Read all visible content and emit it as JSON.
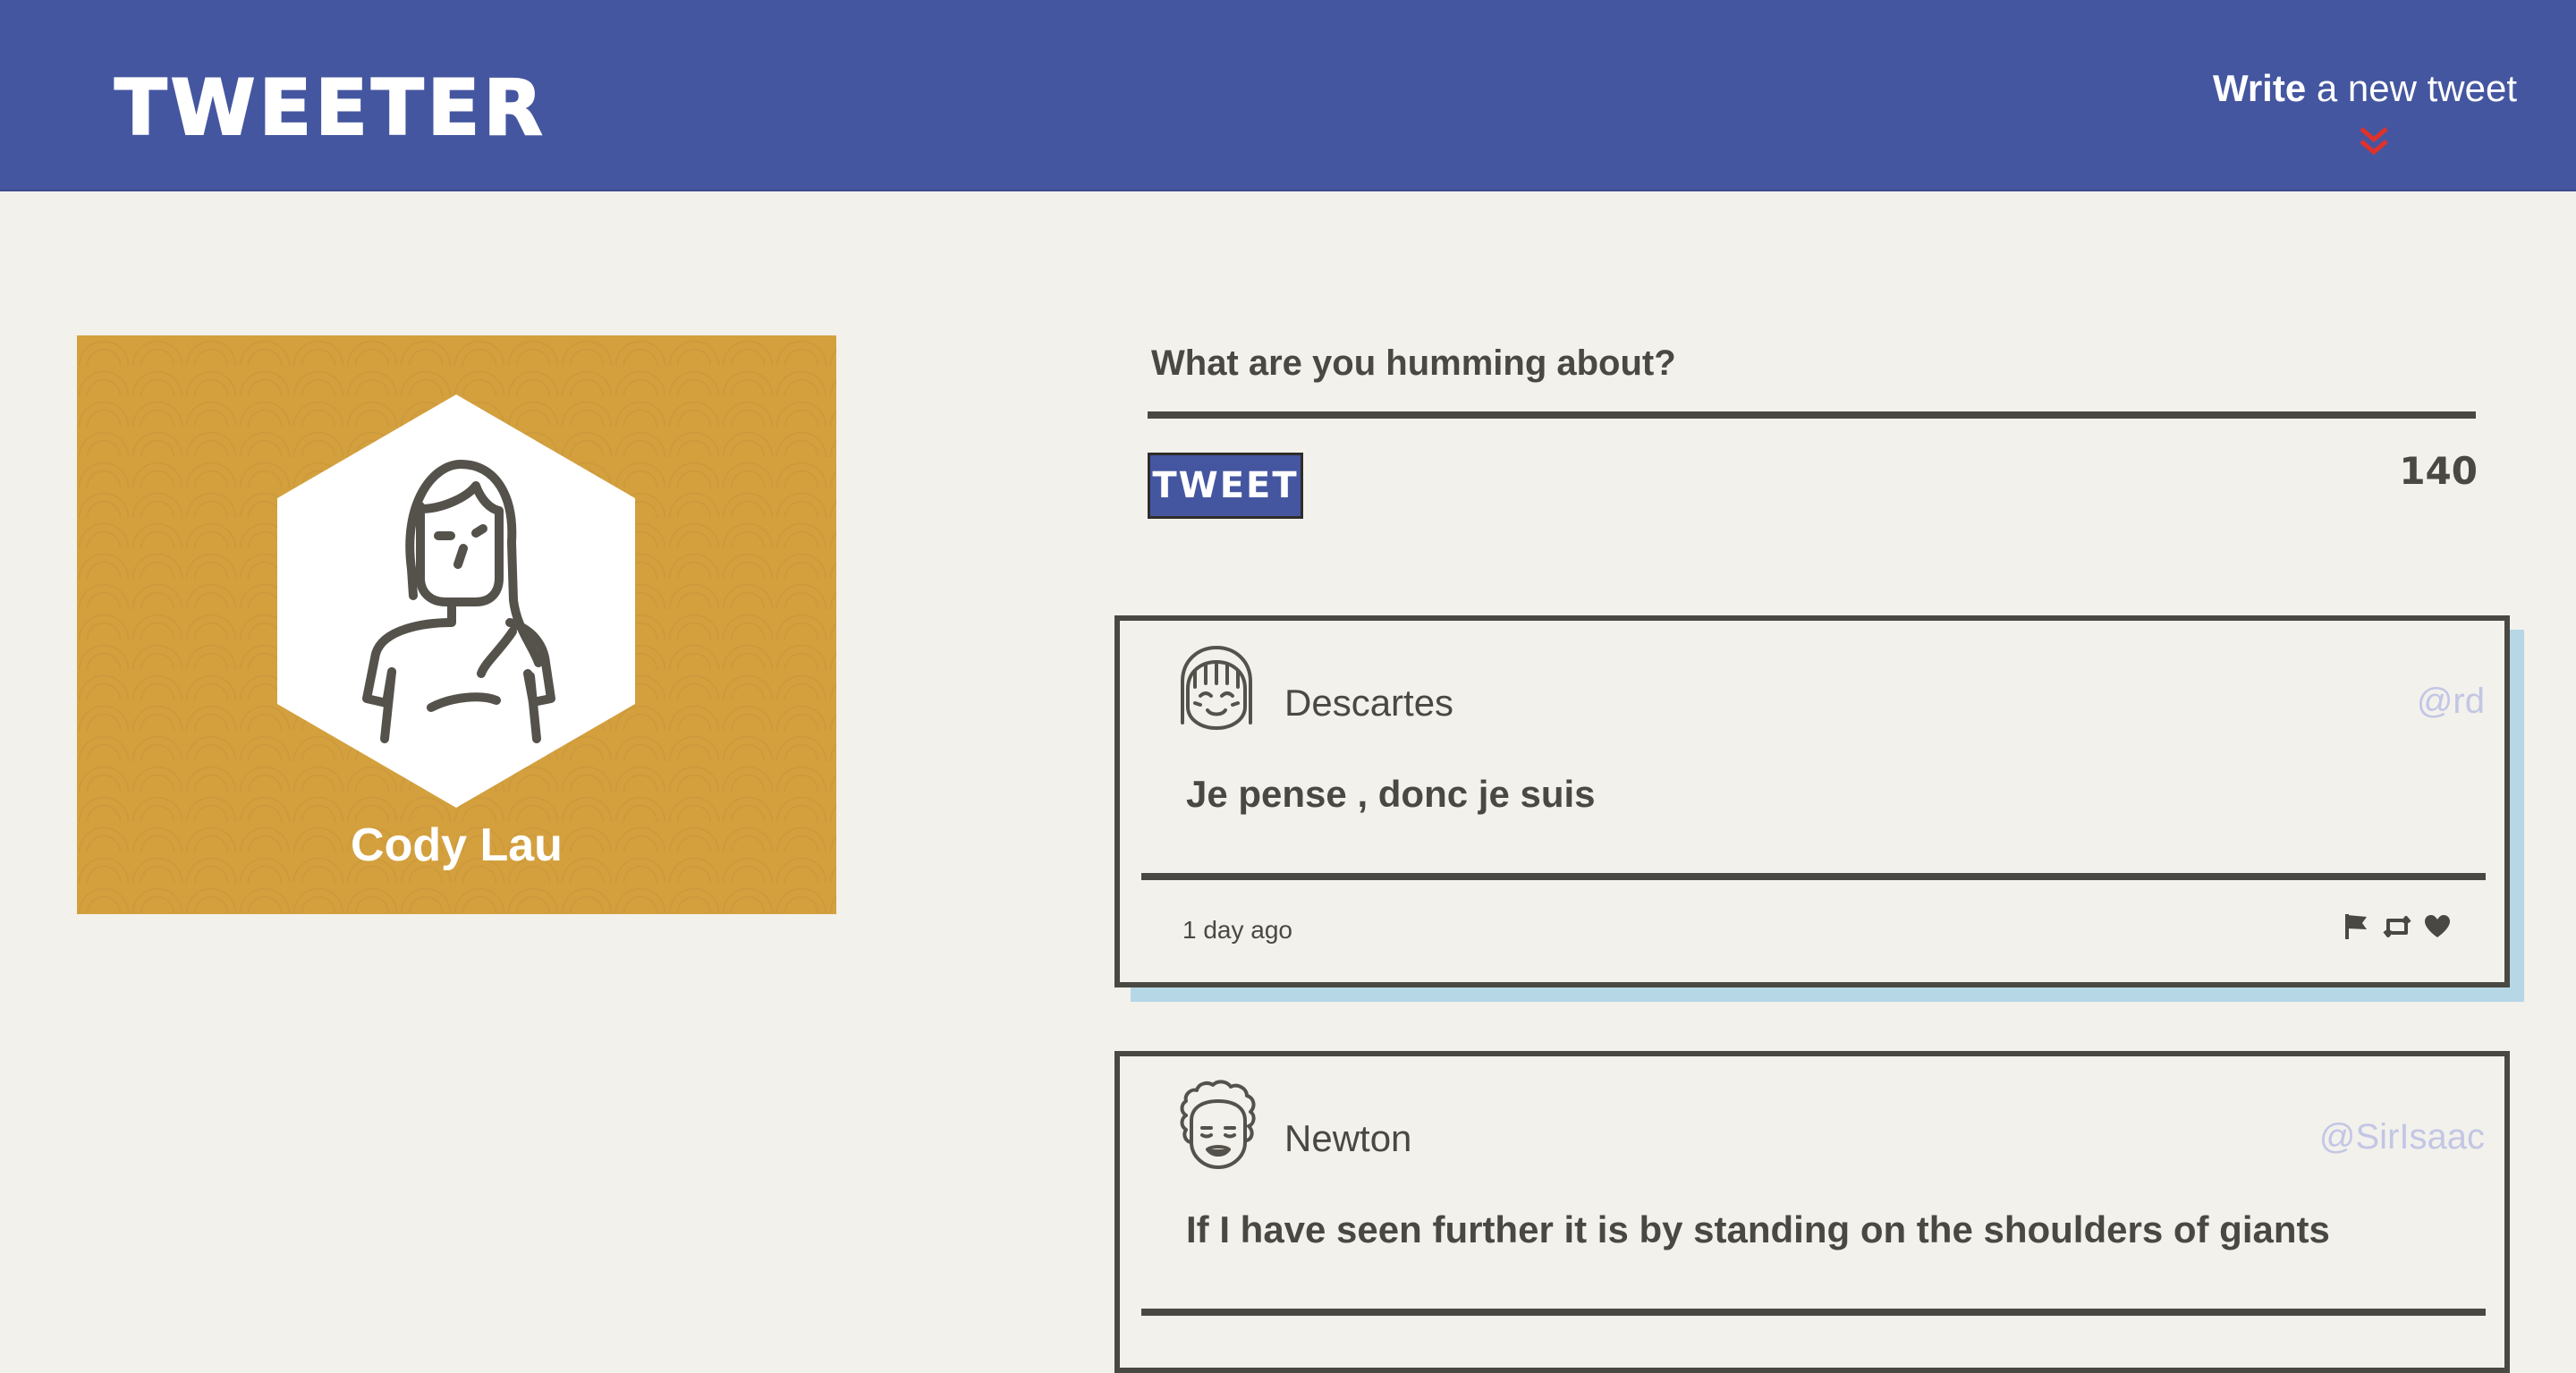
{
  "nav": {
    "brand": "TWEETER",
    "compose_toggle": {
      "strong": "Write",
      "rest": " a new tweet"
    },
    "icons": [
      "chevron-double-down-icon"
    ]
  },
  "profile": {
    "name": "Cody Lau",
    "background_color": "#d4a03e"
  },
  "compose": {
    "prompt": "What are you humming about?",
    "tweet_button": "TWEET",
    "counter": "140"
  },
  "tweets": [
    {
      "author": "Descartes",
      "handle": "@rd",
      "body": "Je pense , donc je suis",
      "time": "1 day ago",
      "actions": [
        "flag-icon",
        "retweet-icon",
        "heart-icon"
      ]
    },
    {
      "author": "Newton",
      "handle": "@SirIsaac",
      "body": "If I have seen further it is by standing on the shoulders of giants"
    }
  ],
  "colors": {
    "nav": "#4556a0",
    "page": "#f2f1ec",
    "text": "#4a4842",
    "hover_shadow": "#b5d7e6",
    "handle": "#c3c6e4",
    "chevron": "#e0322a"
  }
}
